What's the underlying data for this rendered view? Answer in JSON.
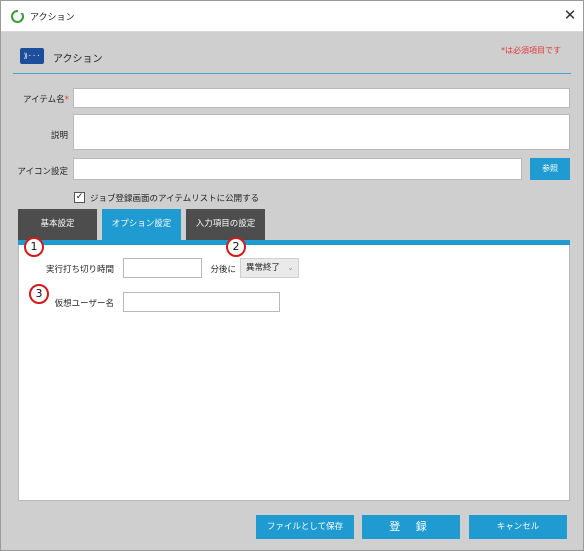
{
  "window": {
    "title": "アクション",
    "close_glyph": "✕"
  },
  "header": {
    "icon_glyph": "⟫···",
    "title": "アクション",
    "required_note": "*は必須項目です"
  },
  "form": {
    "item_name": {
      "label": "アイテム名",
      "required_mark": "*",
      "value": ""
    },
    "description": {
      "label": "説明",
      "value": ""
    },
    "icon_setting": {
      "label": "アイコン設定",
      "value": "",
      "browse_label": "参照"
    },
    "publish": {
      "label": "ジョブ登録画面のアイテムリストに公開する",
      "checked": true,
      "check_glyph": "✓"
    }
  },
  "tabs": [
    {
      "label": "基本設定",
      "active": false
    },
    {
      "label": "オプション設定",
      "active": true
    },
    {
      "label": "入力項目の設定",
      "active": false
    }
  ],
  "options": {
    "timeout": {
      "label": "実行打ち切り時間",
      "value": "",
      "unit": "分後に",
      "action": "異常終了",
      "chevron": "⌄"
    },
    "virtual_user": {
      "label": "仮想ユーザー名",
      "value": ""
    }
  },
  "markers": [
    "1",
    "2",
    "3"
  ],
  "footer": {
    "save_file_label": "ファイルとして保存",
    "register_label": "登 録",
    "cancel_label": "キャンセル"
  },
  "colors": {
    "accent": "#1f9bd1",
    "tab_inactive": "#4d4d4d",
    "required": "#e23a3a",
    "marker": "#d11a1a"
  }
}
